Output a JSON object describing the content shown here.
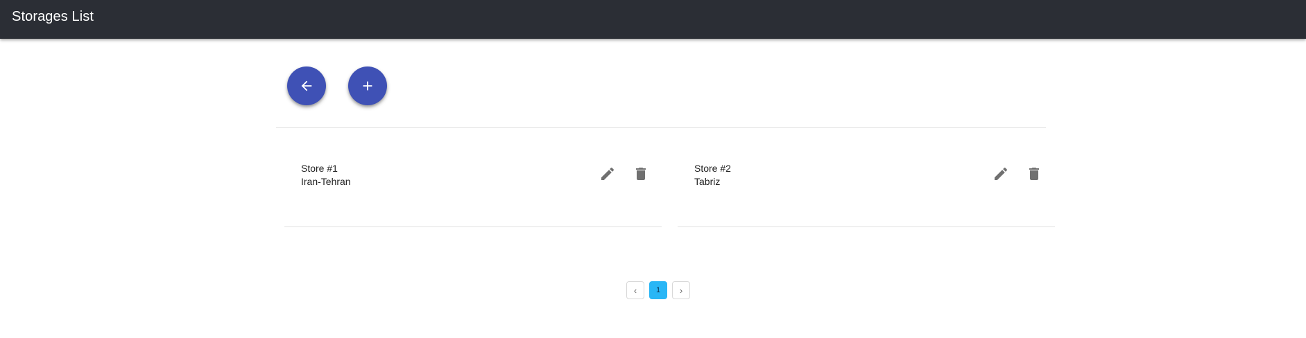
{
  "app_bar": {
    "title": "Storages List",
    "background": "#2b2e35"
  },
  "actions": {
    "back_icon": "arrow-left-icon",
    "add_icon": "plus-icon",
    "fab_color": "#3f51b5"
  },
  "storages": [
    {
      "name": "Store #1",
      "location": "Iran-Tehran",
      "edit_icon": "pencil-icon",
      "delete_icon": "trash-icon"
    },
    {
      "name": "Store #2",
      "location": "Tabriz",
      "edit_icon": "pencil-icon",
      "delete_icon": "trash-icon"
    }
  ],
  "pagination": {
    "prev_label": "‹",
    "current_page": "1",
    "next_label": "›",
    "active_color": "#29b6f6"
  }
}
